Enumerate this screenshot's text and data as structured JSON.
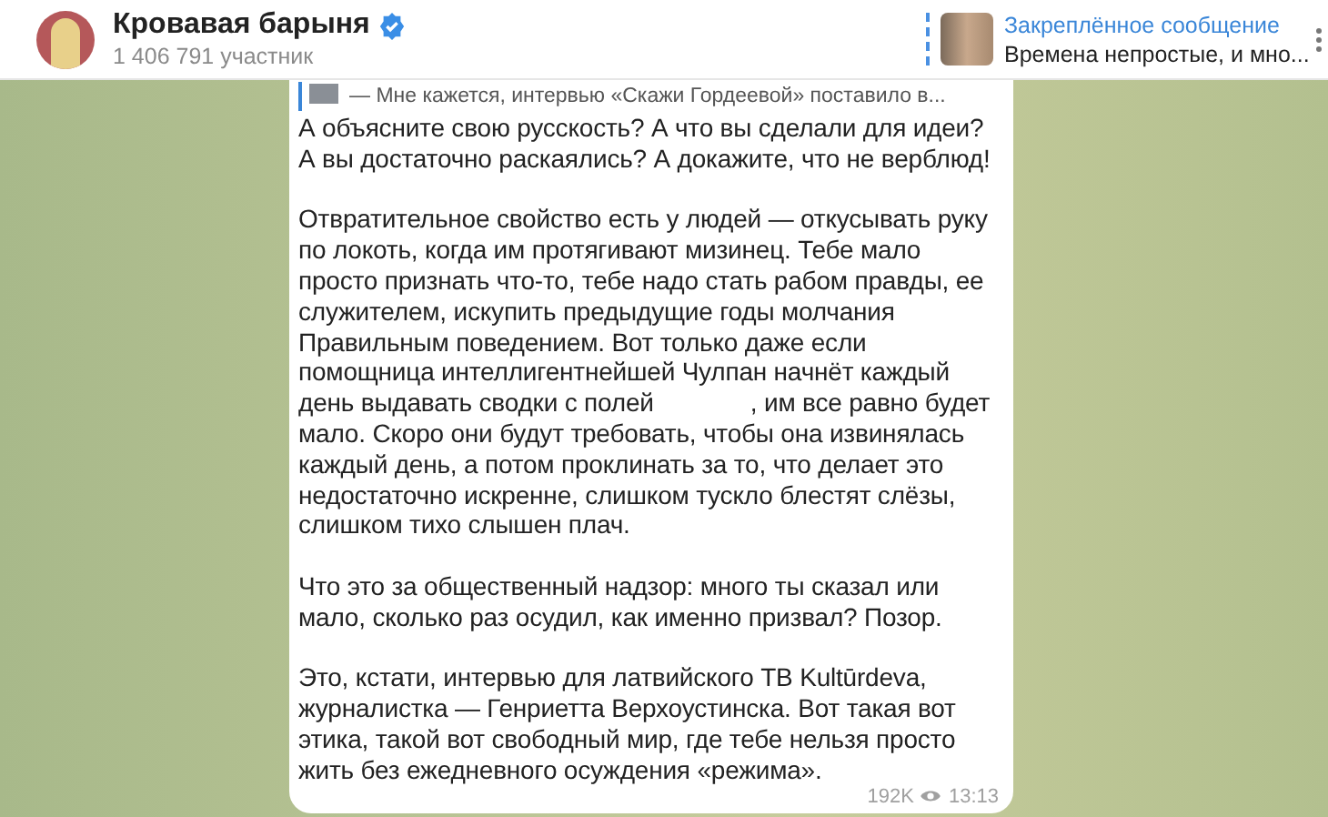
{
  "channel": {
    "name": "Кровавая барыня",
    "verified": true,
    "members": "1 406 791 участник"
  },
  "pinned": {
    "title": "Закреплённое сообщение",
    "text": "Времена непростые, и мно..."
  },
  "message": {
    "reply": "— Мне кажется, интервью «Скажи Гордеевой» поставило в...",
    "paragraphs": [
      "А объясните свою русскость? А что вы сделали для идеи?\nА вы достаточно раскаялись? А докажите, что не верблюд!",
      "Отвратительное свойство есть у людей — откусывать руку\nпо локоть, когда им протягивают мизинец. Тебе мало\nпросто признать что-то, тебе надо стать рабом правды, ее\nслужителем, искупить предыдущие годы молчания\nПравильным поведением. Вот только даже если\nпомощница интеллигентнейшей Чулпан начнёт каждый\nдень выдавать сводки с полей              , им все равно будет\nмало. Скоро они будут требовать, чтобы она извинялась\nкаждый день, а потом проклинать за то, что делает это\nнедостаточно искренне, слишком тускло блестят слёзы,\nслишком тихо слышен плач.",
      "Что это за общественный надзор: много ты сказал или\nмало, сколько раз осудил, как именно призвал? Позор.",
      "Это, кстати, интервью для латвийского ТВ Kultūrdeva,\nжурналистка — Генриетта Верхоустинска. Вот такая вот\nэтика, такой вот свободный мир, где тебе нельзя просто\nжить без ежедневного осуждения «режима»."
    ],
    "views": "192K",
    "time": "13:13"
  }
}
